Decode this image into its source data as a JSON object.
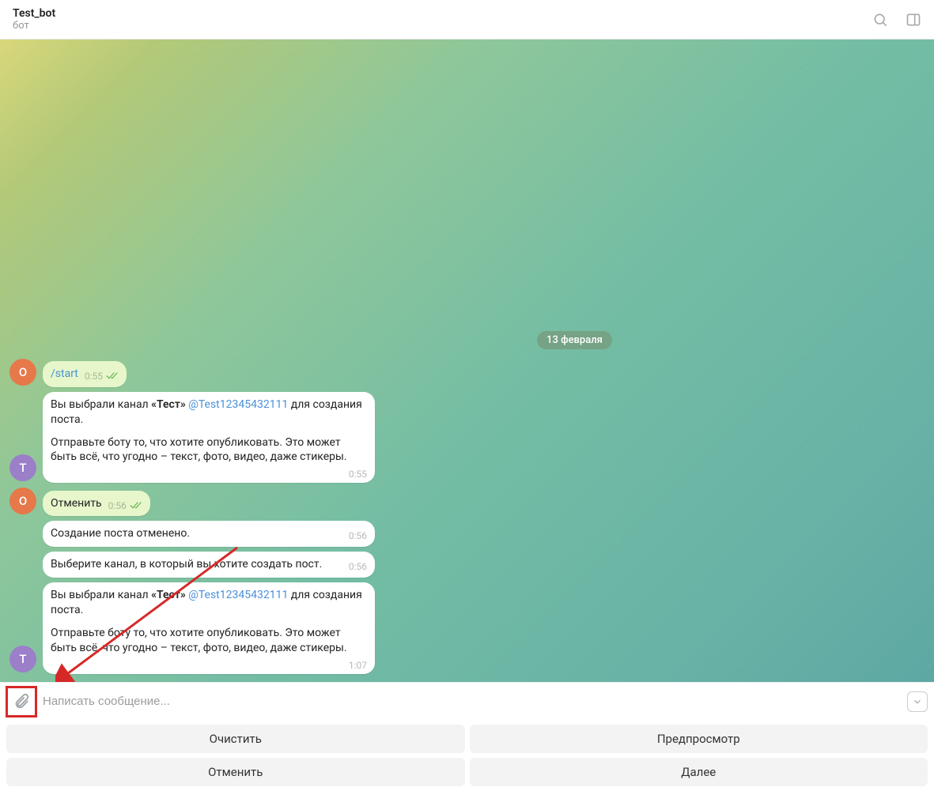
{
  "header": {
    "title": "Test_bot",
    "subtitle": "бот"
  },
  "date_label": "13 февраля",
  "avatars": {
    "user": "O",
    "bot": "T"
  },
  "messages": {
    "m1": {
      "text": "/start",
      "time": "0:55"
    },
    "m2": {
      "part1a": "Вы выбрали канал ",
      "part1b": "«Тест»",
      "link": "@Test12345432111",
      "part1c": " для создания поста.",
      "part2": "Отправьте боту то, что хотите опубликовать. Это может быть всё, что угодно – текст, фото, видео, даже стикеры.",
      "time": "0:55"
    },
    "m3": {
      "text": "Отменить",
      "time": "0:56"
    },
    "m4": {
      "text": "Создание поста отменено.",
      "time": "0:56"
    },
    "m5": {
      "text": "Выберите канал, в который вы хотите создать пост.",
      "time": "0:56"
    },
    "m6": {
      "part1a": "Вы выбрали канал ",
      "part1b": "«Тест»",
      "link": "@Test12345432111",
      "part1c": " для создания поста.",
      "part2": "Отправьте боту то, что хотите опубликовать. Это может быть всё, что угодно – текст, фото, видео, даже стикеры.",
      "time": "1:07"
    }
  },
  "input": {
    "placeholder": "Написать сообщение..."
  },
  "buttons": {
    "clear": "Очистить",
    "preview": "Предпросмотр",
    "cancel": "Отменить",
    "next": "Далее"
  }
}
